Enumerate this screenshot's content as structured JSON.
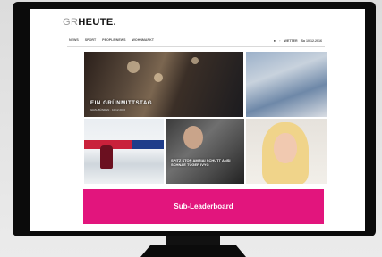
{
  "site": {
    "logo_prefix": "GR",
    "logo_main": "HEUTE."
  },
  "nav": {
    "items": [
      "NEWS",
      "SPORT",
      "PEOPLE/NEWS",
      "WOHNMARKT"
    ],
    "right_icons": [
      "search-icon",
      "user-icon"
    ],
    "weather_label": "WETTER",
    "date_label": "Sa 10.12.2016"
  },
  "tiles": [
    {
      "caption": "EIN GRÜNMITTSTAG",
      "sub": "GRAUBÜNDEN · 10.12.2016"
    },
    {
      "caption": ""
    },
    {
      "caption": ""
    },
    {
      "caption": "SPITZ STOR AMRIAI SCHUTT ANSI SCHNAE TÜGER IVYG"
    },
    {
      "caption": ""
    }
  ],
  "ad": {
    "label": "Sub-Leaderboard",
    "color": "#e2157d"
  },
  "colors": {
    "frame": "#0b0b0b",
    "screen": "#ffffff",
    "wall": "#e6e6e6"
  }
}
